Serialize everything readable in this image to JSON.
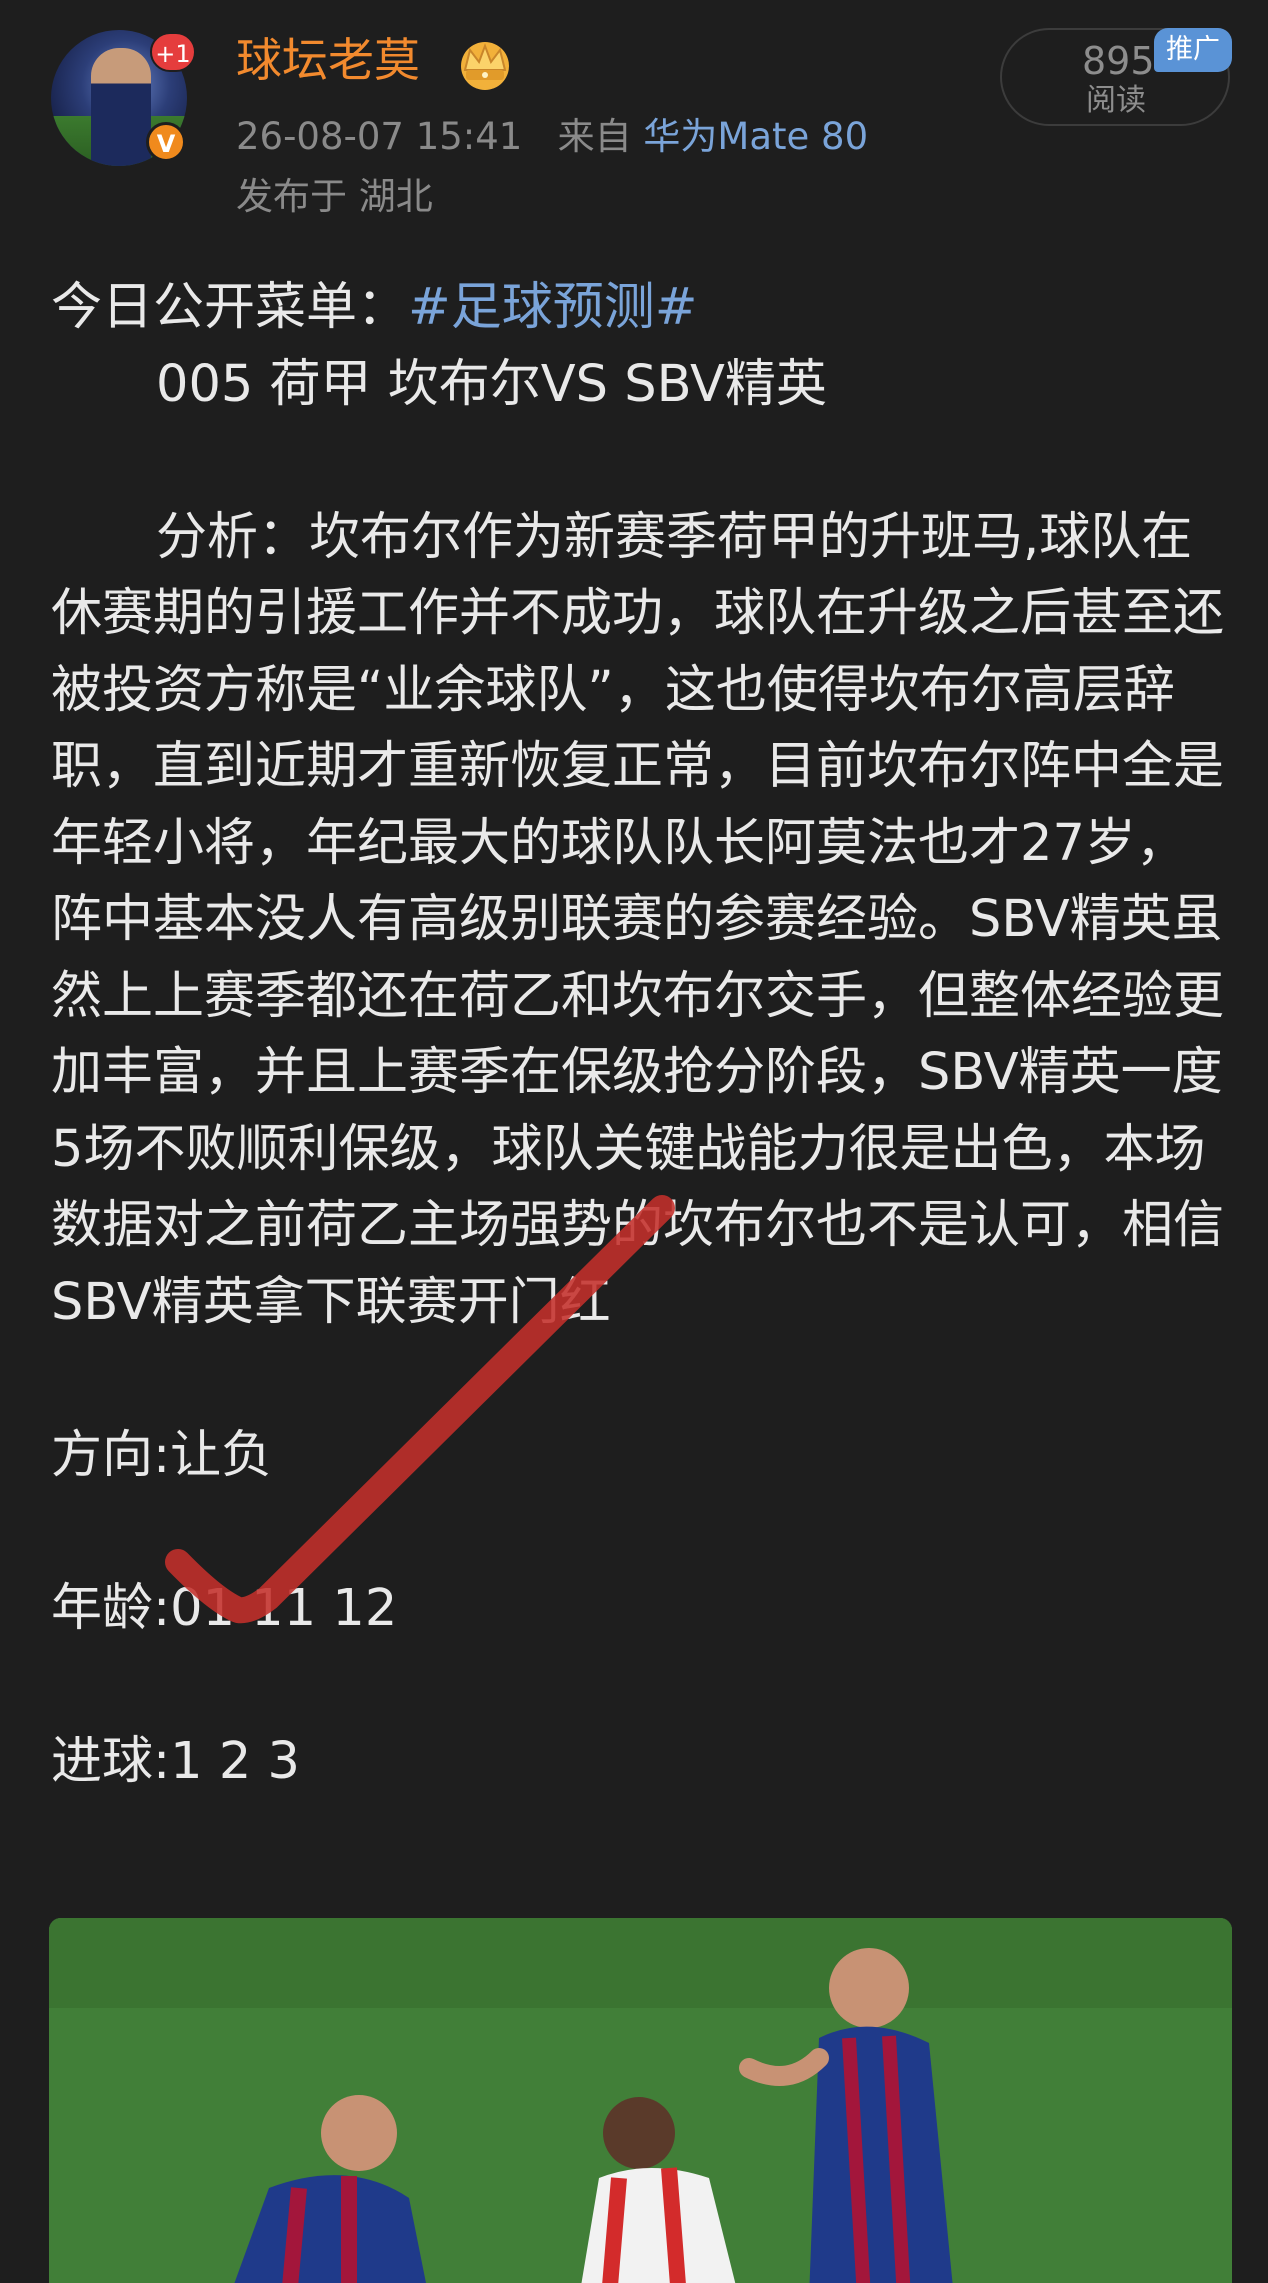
{
  "header": {
    "username": "球坛老莫",
    "avatar_badge": "+1",
    "verified_badge": "V",
    "timestamp": "26-08-07 15:41",
    "source_prefix": "来自",
    "device": "华为Mate 80",
    "location": "发布于 湖北",
    "read_count": "895",
    "read_label": "阅读",
    "promo_tag": "推广"
  },
  "post": {
    "menu_label": "今日公开菜单：",
    "hashtag": "#足球预测#",
    "match_line": "005 荷甲 坎布尔VS SBV精英",
    "analysis": "分析：坎布尔作为新赛季荷甲的升班马,球队在休赛期的引援工作并不成功，球队在升级之后甚至还被投资方称是“业余球队”，这也使得坎布尔高层辞职，直到近期才重新恢复正常，目前坎布尔阵中全是年轻小将，年纪最大的球队队长阿莫法也才27岁，阵中基本没人有高级别联赛的参赛经验。SBV精英虽然上上赛季都还在荷乙和坎布尔交手，但整体经验更加丰富，并且上赛季在保级抢分阶段，SBV精英一度5场不败顺利保级，球队关键战能力很是出色，本场数据对之前荷乙主场强势的坎布尔也不是认可，相信SBV精英拿下联赛开门红",
    "direction": "方向:让负",
    "age": "年龄:01     11     12",
    "goals": "进球:1       2       3"
  },
  "colors": {
    "background": "#1e1e1e",
    "text": "#e9e9e9",
    "username": "#f28a2e",
    "link": "#7aa4d9",
    "meta": "#8a8a8a",
    "checkmark": "#c4302b"
  },
  "icons": [
    "crown-icon",
    "checkmark-icon"
  ]
}
